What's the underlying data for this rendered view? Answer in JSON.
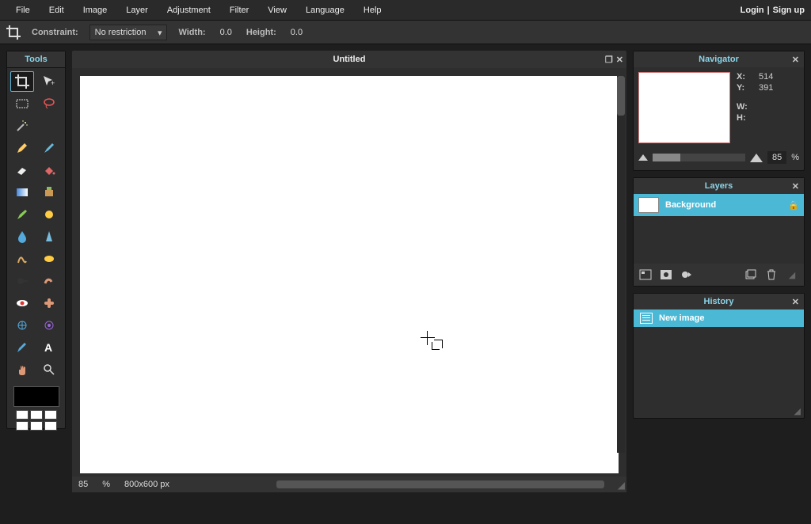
{
  "menu": {
    "items": [
      "File",
      "Edit",
      "Image",
      "Layer",
      "Adjustment",
      "Filter",
      "View",
      "Language",
      "Help"
    ],
    "login": "Login",
    "sep": "|",
    "signup": "Sign up"
  },
  "options": {
    "constraint_label": "Constraint:",
    "constraint_value": "No restriction",
    "width_label": "Width:",
    "width_value": "0.0",
    "height_label": "Height:",
    "height_value": "0.0"
  },
  "tools": {
    "title": "Tools"
  },
  "canvas": {
    "title": "Untitled",
    "zoom": "85",
    "pct": "%",
    "dims": "800x600 px"
  },
  "navigator": {
    "title": "Navigator",
    "x_label": "X:",
    "x": "514",
    "y_label": "Y:",
    "y": "391",
    "w_label": "W:",
    "w": "",
    "h_label": "H:",
    "h": "",
    "zoom": "85",
    "pct": "%"
  },
  "layers": {
    "title": "Layers",
    "items": [
      {
        "name": "Background"
      }
    ]
  },
  "history": {
    "title": "History",
    "items": [
      {
        "name": "New image"
      }
    ]
  }
}
